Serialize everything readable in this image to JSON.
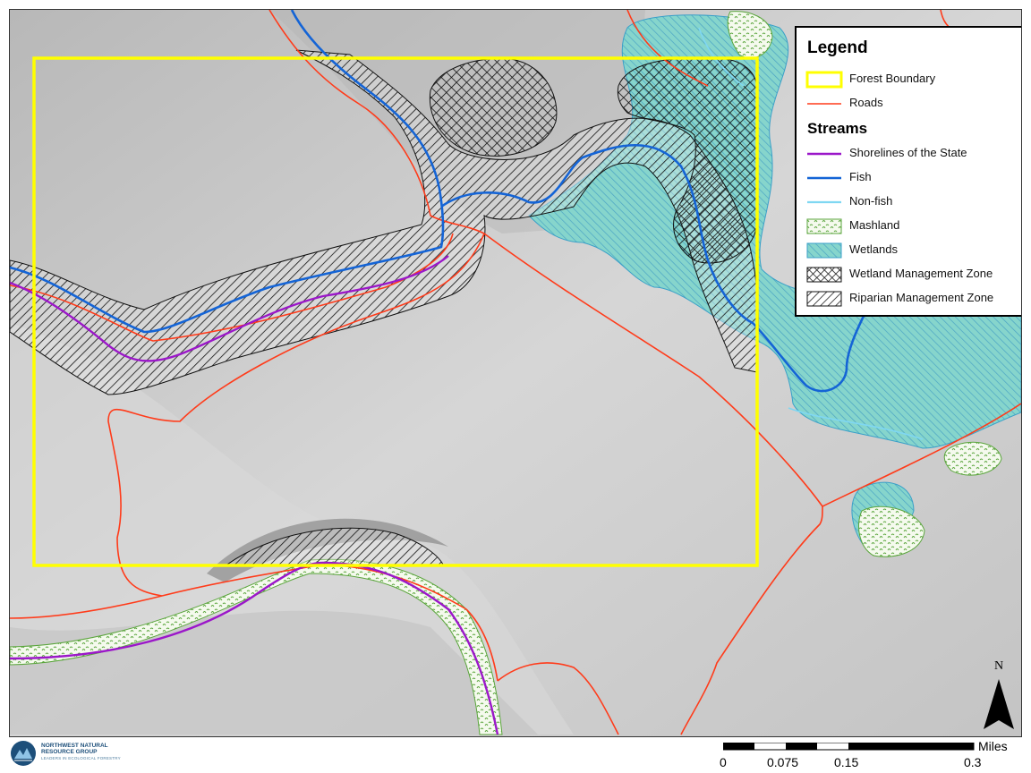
{
  "legend": {
    "title": "Legend",
    "streams_heading": "Streams",
    "items": [
      {
        "label": "Forest Boundary",
        "color": "#ffff00"
      },
      {
        "label": "Roads",
        "color": "#ff3b1a"
      }
    ],
    "stream_items": [
      {
        "label": "Shorelines of the State",
        "color": "#9b17c9"
      },
      {
        "label": "Fish",
        "color": "#1464d6"
      },
      {
        "label": "Non-fish",
        "color": "#7fd7f2"
      },
      {
        "label": "Mashland",
        "color": "#6ab04c"
      },
      {
        "label": "Wetlands",
        "color": "#79d2cf"
      },
      {
        "label": "Wetland Management Zone",
        "color": "#000000"
      },
      {
        "label": "Riparian Management Zone",
        "color": "#000000"
      }
    ]
  },
  "north_arrow": {
    "letter": "N"
  },
  "scale_bar": {
    "unit": "Miles",
    "ticks": [
      "0",
      "0.075",
      "0.15",
      "0.3"
    ]
  },
  "logo": {
    "line1": "NORTHWEST NATURAL",
    "line2": "RESOURCE GROUP",
    "tagline": "LEADERS IN ECOLOGICAL FORESTRY"
  },
  "colors": {
    "forest_boundary": "#ffff00",
    "roads": "#ff3b1a",
    "shoreline": "#9b17c9",
    "fish": "#1464d6",
    "nonfish": "#7fd7f2",
    "wetland_fill": "#8fd9d2",
    "mashland_fill": "#f4fbe8",
    "hillshade": "#c9c9c9"
  }
}
